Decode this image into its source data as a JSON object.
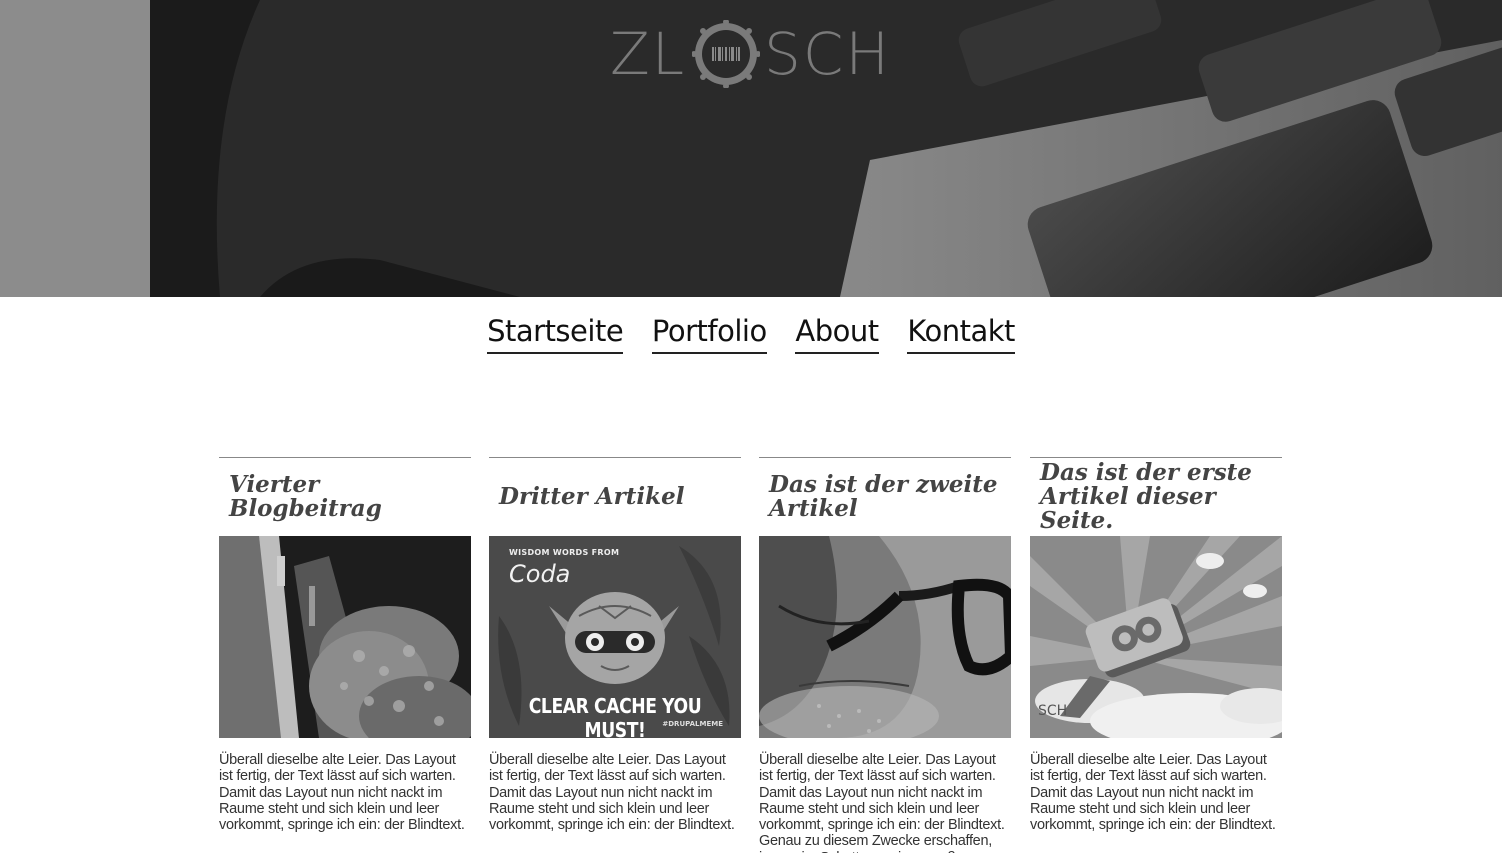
{
  "logo": {
    "text_left": "ZL",
    "text_right": "SCH"
  },
  "nav": {
    "items": [
      {
        "label": "Startseite"
      },
      {
        "label": "Portfolio"
      },
      {
        "label": "About"
      },
      {
        "label": "Kontakt"
      }
    ]
  },
  "articles": [
    {
      "title": "Vierter Blogbeitrag",
      "image": "chairs-photo",
      "excerpt": "Überall dieselbe alte Leier. Das Layout ist fertig, der Text lässt auf sich warten. Damit das Layout nun nicht nackt im Raume steht und sich klein und leer vorkommt, springe ich ein: der Blindtext."
    },
    {
      "title": "Dritter Artikel",
      "image": "drupal-meme",
      "meme_small": "WISDOM WORDS FROM",
      "meme_coda": "Coda",
      "meme_big": "CLEAR CACHE YOU MUST!",
      "meme_tag": "#DRUPALMEME",
      "excerpt": "Überall dieselbe alte Leier. Das Layout ist fertig, der Text lässt auf sich warten. Damit das Layout nun nicht nackt im Raume steht und sich klein und leer vorkommt, springe ich ein: der Blindtext."
    },
    {
      "title": "Das ist der zweite Artikel",
      "image": "glasses-portrait",
      "excerpt": "Überall dieselbe alte Leier. Das Layout ist fertig, der Text lässt auf sich warten. Damit das Layout nun nicht nackt im Raume steht und sich klein und leer vorkommt, springe ich ein: der Blindtext. Genau zu diesem Zwecke erschaffen, immer im Schatten meines großen Bruders"
    },
    {
      "title": "Das ist der erste Artikel dieser Seite.",
      "image": "drupal8-illustration",
      "image_text": "SCH",
      "excerpt": "Überall dieselbe alte Leier. Das Layout ist fertig, der Text lässt auf sich warten. Damit das Layout nun nicht nackt im Raume steht und sich klein und leer vorkommt, springe ich ein: der Blindtext."
    }
  ]
}
